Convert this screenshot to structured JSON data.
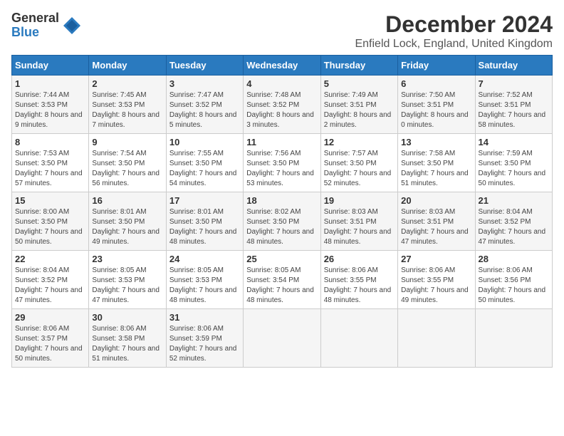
{
  "logo": {
    "general": "General",
    "blue": "Blue"
  },
  "header": {
    "title": "December 2024",
    "subtitle": "Enfield Lock, England, United Kingdom"
  },
  "columns": [
    "Sunday",
    "Monday",
    "Tuesday",
    "Wednesday",
    "Thursday",
    "Friday",
    "Saturday"
  ],
  "weeks": [
    [
      {
        "day": "1",
        "sunrise": "7:44 AM",
        "sunset": "3:53 PM",
        "daylight": "8 hours and 9 minutes."
      },
      {
        "day": "2",
        "sunrise": "7:45 AM",
        "sunset": "3:53 PM",
        "daylight": "8 hours and 7 minutes."
      },
      {
        "day": "3",
        "sunrise": "7:47 AM",
        "sunset": "3:52 PM",
        "daylight": "8 hours and 5 minutes."
      },
      {
        "day": "4",
        "sunrise": "7:48 AM",
        "sunset": "3:52 PM",
        "daylight": "8 hours and 3 minutes."
      },
      {
        "day": "5",
        "sunrise": "7:49 AM",
        "sunset": "3:51 PM",
        "daylight": "8 hours and 2 minutes."
      },
      {
        "day": "6",
        "sunrise": "7:50 AM",
        "sunset": "3:51 PM",
        "daylight": "8 hours and 0 minutes."
      },
      {
        "day": "7",
        "sunrise": "7:52 AM",
        "sunset": "3:51 PM",
        "daylight": "7 hours and 58 minutes."
      }
    ],
    [
      {
        "day": "8",
        "sunrise": "7:53 AM",
        "sunset": "3:50 PM",
        "daylight": "7 hours and 57 minutes."
      },
      {
        "day": "9",
        "sunrise": "7:54 AM",
        "sunset": "3:50 PM",
        "daylight": "7 hours and 56 minutes."
      },
      {
        "day": "10",
        "sunrise": "7:55 AM",
        "sunset": "3:50 PM",
        "daylight": "7 hours and 54 minutes."
      },
      {
        "day": "11",
        "sunrise": "7:56 AM",
        "sunset": "3:50 PM",
        "daylight": "7 hours and 53 minutes."
      },
      {
        "day": "12",
        "sunrise": "7:57 AM",
        "sunset": "3:50 PM",
        "daylight": "7 hours and 52 minutes."
      },
      {
        "day": "13",
        "sunrise": "7:58 AM",
        "sunset": "3:50 PM",
        "daylight": "7 hours and 51 minutes."
      },
      {
        "day": "14",
        "sunrise": "7:59 AM",
        "sunset": "3:50 PM",
        "daylight": "7 hours and 50 minutes."
      }
    ],
    [
      {
        "day": "15",
        "sunrise": "8:00 AM",
        "sunset": "3:50 PM",
        "daylight": "7 hours and 50 minutes."
      },
      {
        "day": "16",
        "sunrise": "8:01 AM",
        "sunset": "3:50 PM",
        "daylight": "7 hours and 49 minutes."
      },
      {
        "day": "17",
        "sunrise": "8:01 AM",
        "sunset": "3:50 PM",
        "daylight": "7 hours and 48 minutes."
      },
      {
        "day": "18",
        "sunrise": "8:02 AM",
        "sunset": "3:50 PM",
        "daylight": "7 hours and 48 minutes."
      },
      {
        "day": "19",
        "sunrise": "8:03 AM",
        "sunset": "3:51 PM",
        "daylight": "7 hours and 48 minutes."
      },
      {
        "day": "20",
        "sunrise": "8:03 AM",
        "sunset": "3:51 PM",
        "daylight": "7 hours and 47 minutes."
      },
      {
        "day": "21",
        "sunrise": "8:04 AM",
        "sunset": "3:52 PM",
        "daylight": "7 hours and 47 minutes."
      }
    ],
    [
      {
        "day": "22",
        "sunrise": "8:04 AM",
        "sunset": "3:52 PM",
        "daylight": "7 hours and 47 minutes."
      },
      {
        "day": "23",
        "sunrise": "8:05 AM",
        "sunset": "3:53 PM",
        "daylight": "7 hours and 47 minutes."
      },
      {
        "day": "24",
        "sunrise": "8:05 AM",
        "sunset": "3:53 PM",
        "daylight": "7 hours and 48 minutes."
      },
      {
        "day": "25",
        "sunrise": "8:05 AM",
        "sunset": "3:54 PM",
        "daylight": "7 hours and 48 minutes."
      },
      {
        "day": "26",
        "sunrise": "8:06 AM",
        "sunset": "3:55 PM",
        "daylight": "7 hours and 48 minutes."
      },
      {
        "day": "27",
        "sunrise": "8:06 AM",
        "sunset": "3:55 PM",
        "daylight": "7 hours and 49 minutes."
      },
      {
        "day": "28",
        "sunrise": "8:06 AM",
        "sunset": "3:56 PM",
        "daylight": "7 hours and 50 minutes."
      }
    ],
    [
      {
        "day": "29",
        "sunrise": "8:06 AM",
        "sunset": "3:57 PM",
        "daylight": "7 hours and 50 minutes."
      },
      {
        "day": "30",
        "sunrise": "8:06 AM",
        "sunset": "3:58 PM",
        "daylight": "7 hours and 51 minutes."
      },
      {
        "day": "31",
        "sunrise": "8:06 AM",
        "sunset": "3:59 PM",
        "daylight": "7 hours and 52 minutes."
      },
      null,
      null,
      null,
      null
    ]
  ]
}
